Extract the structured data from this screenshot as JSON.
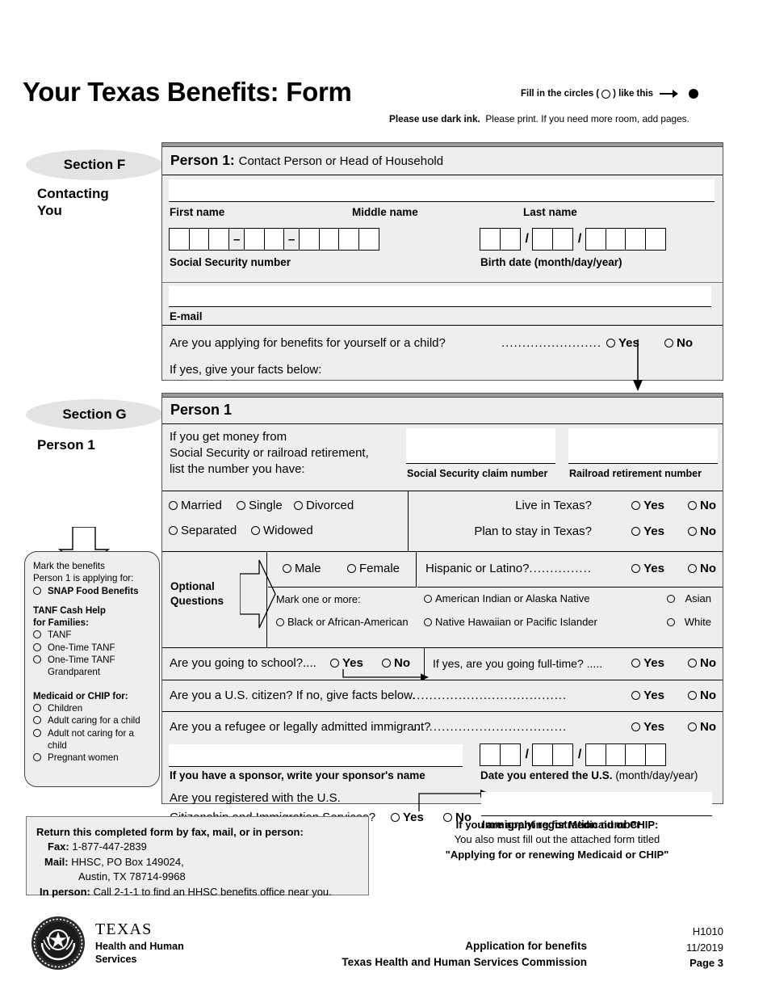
{
  "header": {
    "title": "Your Texas Benefits: Form",
    "fill_note_prefix": "Fill in the circles (",
    "fill_note_suffix": ") like this",
    "ink_note_bold": "Please use dark ink.",
    "ink_note_rest": "Please print. If you need more room, add pages."
  },
  "section_f": {
    "badge": "Section F",
    "subtitle": "Contacting\nYou",
    "person_label": "Person 1:",
    "person_sub": "Contact Person or Head of Household",
    "first_name": "First name",
    "middle_name": "Middle name",
    "last_name": "Last name",
    "ssn_label": "Social Security number",
    "birth_label": "Birth date (month/day/year)",
    "email_label": "E-mail",
    "apply_question": "Are you applying for benefits for yourself or a child?",
    "apply_dots": "........................",
    "yes": "Yes",
    "no": "No",
    "if_yes": "If yes, give your facts below:"
  },
  "section_g": {
    "badge": "Section G",
    "subtitle": "Person 1",
    "person_label": "Person 1",
    "money_line1": "If you get money from",
    "money_line2": "Social Security or railroad retirement,",
    "money_line3": "list the number you have:",
    "ss_claim_label": "Social Security claim number",
    "railroad_label": "Railroad retirement number",
    "marital": [
      "Married",
      "Single",
      "Divorced",
      "Separated",
      "Widowed"
    ],
    "live_in_texas": "Live in Texas?",
    "plan_to_stay": "Plan to stay in Texas?",
    "optional_questions": "Optional\nQuestions",
    "gender": [
      "Male",
      "Female"
    ],
    "hispanic_question": "Hispanic or Latino?",
    "hispanic_dots": "...............",
    "mark_one_or_more": "Mark one or more:",
    "races": [
      "American Indian or Alaska Native",
      "Asian",
      "Black or African-American",
      "Native Hawaiian or Pacific Islander",
      "White"
    ],
    "school_question": "Are you going to school?....",
    "fulltime_question": "If yes, are you going full-time? .....",
    "citizen_question": "Are you a U.S. citizen? If no, give facts below.",
    "citizen_dots": ".....................................",
    "refugee_question": "Are you a refugee or legally admitted immigrant?",
    "refugee_dots": ".....................................",
    "sponsor_label": "If you have a sponsor, write your sponsor's name",
    "entered_us_bold": "Date you entered the U.S.",
    "entered_us_norm": "(month/day/year)",
    "registered_line1": "Are you registered with the U.S.",
    "registered_line2": "Citizenship and Immigration Services?",
    "immigrant_reg_label": "Immigrant registration number",
    "yes": "Yes",
    "no": "No"
  },
  "benefits_box": {
    "line1": "Mark the benefits",
    "line2": "Person 1 is applying for:",
    "snap": "SNAP Food Benefits",
    "tanf_heading1": "TANF Cash Help",
    "tanf_heading2": "for Families:",
    "tanf_options": [
      "TANF",
      "One-Time TANF",
      "One-Time TANF\nGrandparent"
    ],
    "medicaid_heading": "Medicaid or CHIP for:",
    "medicaid_options": [
      "Children",
      "Adult caring for a child",
      "Adult not caring for a\nchild",
      "Pregnant women"
    ]
  },
  "return_box": {
    "heading": "Return this completed form by fax, mail, or in person:",
    "fax_label": "Fax:",
    "fax_value": "1-877-447-2839",
    "mail_label": "Mail:",
    "mail_value": "HHSC, PO Box 149024,",
    "mail_value2": "Austin, TX 78714-9968",
    "inperson_label": "In person:",
    "inperson_value": "Call 2-1-1 to find an HHSC benefits office near you."
  },
  "medicaid_note": {
    "line1": "If you are applying for Medicaid or CHIP:",
    "line2": "You also must fill out the attached form titled",
    "line3": "\"Applying for or renewing Medicaid or CHIP\""
  },
  "footer": {
    "logo_texas": "TEXAS",
    "logo_hhs_line1": "Health and Human",
    "logo_hhs_line2": "Services",
    "center_line1": "Application for benefits",
    "center_line2": "Texas Health and Human Services Commission",
    "form_number": "H1010",
    "form_date": "11/2019",
    "page": "Page 3"
  }
}
